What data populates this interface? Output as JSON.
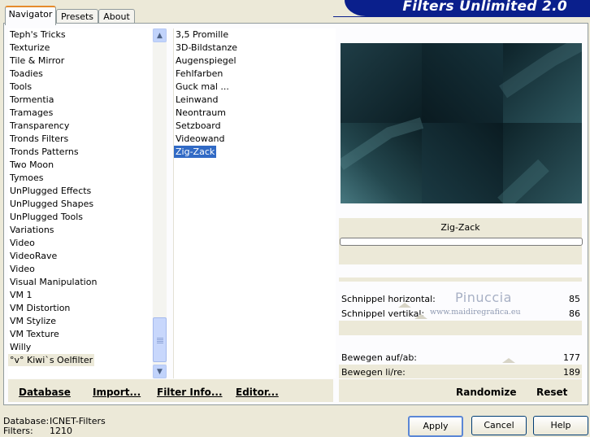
{
  "window": {
    "banner_title": "Filters Unlimited 2.0"
  },
  "tabs": [
    {
      "label": "Navigator",
      "active": true
    },
    {
      "label": "Presets",
      "active": false
    },
    {
      "label": "About",
      "active": false
    }
  ],
  "categories": {
    "items": [
      "Teph's Tricks",
      "Texturize",
      "Tile & Mirror",
      "Toadies",
      "Tools",
      "Tormentia",
      "Tramages",
      "Transparency",
      "Tronds Filters",
      "Tronds Patterns",
      "Two Moon",
      "Tymoes",
      "UnPlugged Effects",
      "UnPlugged Shapes",
      "UnPlugged Tools",
      "Variations",
      "Video",
      "VideoRave",
      "Video",
      "Visual Manipulation",
      "VM 1",
      "VM Distortion",
      "VM Stylize",
      "VM Texture",
      "Willy",
      "°v° Kiwi`s Oelfilter"
    ],
    "selected_index": 25
  },
  "filters": {
    "items": [
      "3,5 Promille",
      "3D-Bildstanze",
      "Augenspiegel",
      "Fehlfarben",
      "Guck mal ...",
      "Leinwand",
      "Neontraum",
      "Setzboard",
      "Videowand",
      "Zig-Zack"
    ],
    "selected_index": 9
  },
  "preview": {
    "filter_name": "Zig-Zack",
    "colors": [
      "#0e2228",
      "#1d3d47",
      "#2f5961",
      "#3d6b74",
      "#102a33",
      "#0b1c22"
    ]
  },
  "params": [
    {
      "label": "Schnippel horizontal:",
      "value": "85"
    },
    {
      "label": "Schnippel vertikal:",
      "value": "86"
    },
    {
      "label": "Bewegen auf/ab:",
      "value": "177"
    },
    {
      "label": "Bewegen li/re:",
      "value": "189"
    }
  ],
  "watermark": {
    "name": "Pinuccia",
    "site": "www.maidiregrafica.eu"
  },
  "actions": {
    "database": "Database",
    "import": "Import...",
    "filter_info": "Filter Info...",
    "editor": "Editor...",
    "randomize": "Randomize",
    "reset": "Reset"
  },
  "buttons": {
    "apply": "Apply",
    "cancel": "Cancel",
    "help": "Help"
  },
  "status": {
    "database_label": "Database:",
    "database_value": "ICNET-Filters",
    "filters_label": "Filters:",
    "filters_value": "1210"
  }
}
